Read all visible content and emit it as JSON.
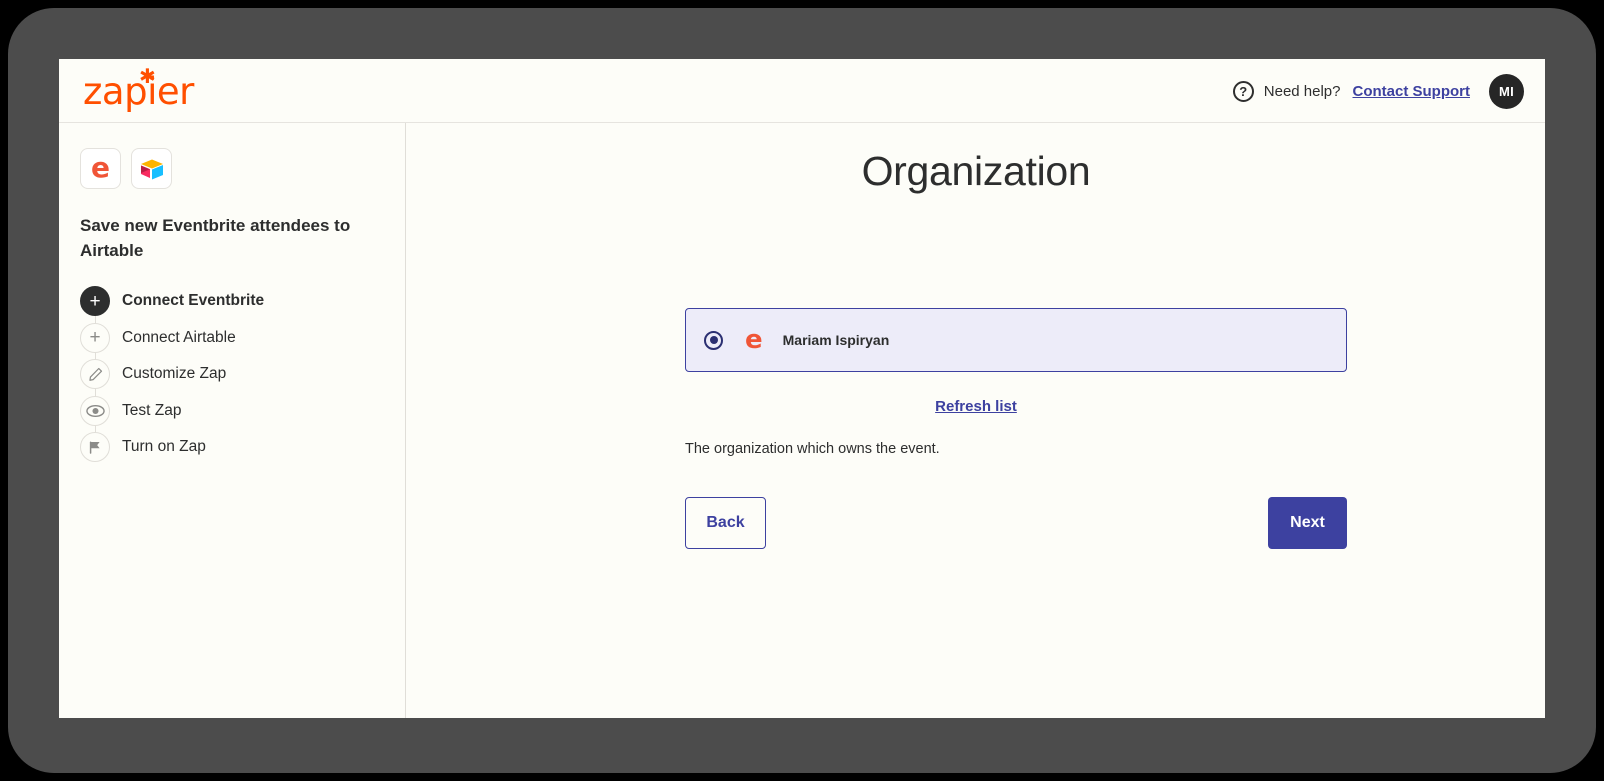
{
  "header": {
    "logo_text": "zapier",
    "logo_color": "#ff4f00",
    "help_icon": "question-circle-icon",
    "need_help_label": "Need help?",
    "contact_support_label": "Contact Support",
    "avatar_initials": "MI"
  },
  "sidebar": {
    "app_icons": [
      {
        "name": "eventbrite-icon",
        "glyph": "e"
      },
      {
        "name": "airtable-icon",
        "glyph": ""
      }
    ],
    "zap_title": "Save new Eventbrite attendees to Airtable",
    "steps": [
      {
        "label": "Connect Eventbrite",
        "icon": "plus-icon",
        "state": "active"
      },
      {
        "label": "Connect Airtable",
        "icon": "plus-icon",
        "state": "inactive"
      },
      {
        "label": "Customize Zap",
        "icon": "pencil-icon",
        "state": "inactive"
      },
      {
        "label": "Test Zap",
        "icon": "eye-icon",
        "state": "inactive"
      },
      {
        "label": "Turn on Zap",
        "icon": "flag-icon",
        "state": "inactive"
      }
    ]
  },
  "main": {
    "title": "Organization",
    "option": {
      "selected": true,
      "app_icon": "eventbrite-icon",
      "app_glyph": "e",
      "label": "Mariam Ispiryan"
    },
    "refresh_link": "Refresh list",
    "help_text": "The organization which owns the event.",
    "back_label": "Back",
    "next_label": "Next"
  },
  "colors": {
    "brand_orange": "#ff4f00",
    "accent_indigo": "#3d41a0",
    "card_background": "#edecf9",
    "page_background": "#fdfdf8",
    "eventbrite_orange": "#f05537"
  }
}
